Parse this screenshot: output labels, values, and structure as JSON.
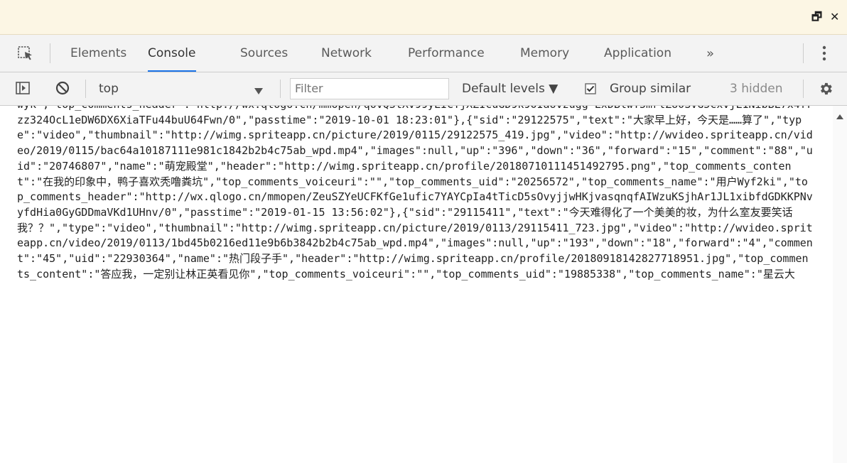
{
  "window": {
    "restore_glyph": "🗗",
    "close_glyph": "✕"
  },
  "tabs": [
    {
      "label": "Elements"
    },
    {
      "label": "Console"
    },
    {
      "label": "Sources"
    },
    {
      "label": "Network"
    },
    {
      "label": "Performance"
    },
    {
      "label": "Memory"
    },
    {
      "label": "Application"
    }
  ],
  "active_tab": "Console",
  "icons": {
    "inspect": "inspect-element-icon",
    "more_tabs": "chevron-double-right-icon",
    "kebab": "kebab-menu-icon",
    "sidebar": "sidebar-toggle-icon",
    "clear": "clear-console-icon",
    "dropdown": "dropdown-arrow-icon",
    "settings": "gear-icon"
  },
  "toolbar": {
    "context": "top",
    "filter_placeholder": "Filter",
    "levels": "Default levels ▼",
    "group_similar": "Group similar",
    "group_similar_checked": true,
    "hidden": "3 hidden"
  },
  "console": {
    "output": "wyk\",\"top_comments_header\":\"http://wx.qlogo.cn/mmopen/qovQ3tXv99yLICTjXZIcuGD9k9OIaUvzugg LxDBlwT5mrlZU0SVG5cxvjL1NibBL7x4frzz324OcL1eDW6DX6XiaTFu44buU64Fwn/0\",\"passtime\":\"2019-10-01 18:23:01\"},{\"sid\":\"29122575\",\"text\":\"大家早上好，今天是……算了\",\"type\":\"video\",\"thumbnail\":\"http://wimg.spriteapp.cn/picture/2019/0115/29122575_419.jpg\",\"video\":\"http://wvideo.spriteapp.cn/video/2019/0115/bac64a10187111e981c1842b2b4c75ab_wpd.mp4\",\"images\":null,\"up\":\"396\",\"down\":\"36\",\"forward\":\"15\",\"comment\":\"88\",\"uid\":\"20746807\",\"name\":\"萌宠殿堂\",\"header\":\"http://wimg.spriteapp.cn/profile/20180710111451492795.png\",\"top_comments_content\":\"在我的印象中，鸭子喜欢秃噜粪坑\",\"top_comments_voiceuri\":\"\",\"top_comments_uid\":\"20256572\",\"top_comments_name\":\"用户Wyf2ki\",\"top_comments_header\":\"http://wx.qlogo.cn/mmopen/ZeuSZYeUCFKfGe1ufic7YAYCpIa4tTicD5sOvyjjwHKjvasqnqfAIWzuKSjhAr1JL1xibfdGDKKPNvyfdHia0GyGDDmaVKd1UHnv/0\",\"passtime\":\"2019-01-15 13:56:02\"},{\"sid\":\"29115411\",\"text\":\"今天难得化了一个美美的妆，为什么室友要笑话我？？\",\"type\":\"video\",\"thumbnail\":\"http://wimg.spriteapp.cn/picture/2019/0113/29115411_723.jpg\",\"video\":\"http://wvideo.spriteapp.cn/video/2019/0113/1bd45b0216ed11e9b6b3842b2b4c75ab_wpd.mp4\",\"images\":null,\"up\":\"193\",\"down\":\"18\",\"forward\":\"4\",\"comment\":\"45\",\"uid\":\"22930364\",\"name\":\"热门段子手\",\"header\":\"http://wimg.spriteapp.cn/profile/20180918142827718951.jpg\",\"top_comments_content\":\"答应我，一定别让林正英看见你\",\"top_comments_voiceuri\":\"\",\"top_comments_uid\":\"19885338\",\"top_comments_name\":\"星云大"
  }
}
